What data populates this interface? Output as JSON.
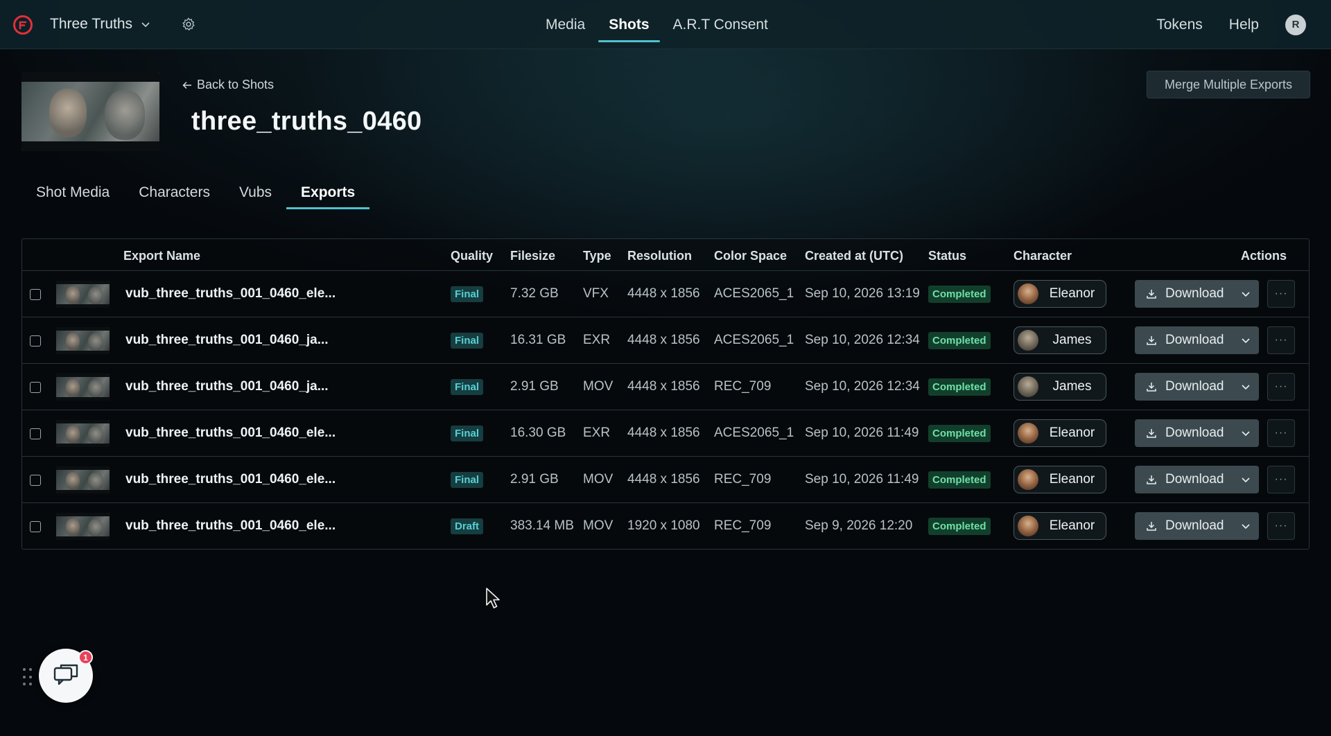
{
  "topnav": {
    "project_name": "Three Truths",
    "items": [
      {
        "label": "Media",
        "active": false
      },
      {
        "label": "Shots",
        "active": true
      },
      {
        "label": "A.R.T Consent",
        "active": false
      }
    ],
    "tokens_label": "Tokens",
    "help_label": "Help",
    "avatar_initial": "R"
  },
  "header": {
    "back_label": "Back to Shots",
    "title": "three_truths_0460",
    "merge_button": "Merge Multiple Exports"
  },
  "tabs": [
    {
      "label": "Shot Media",
      "active": false
    },
    {
      "label": "Characters",
      "active": false
    },
    {
      "label": "Vubs",
      "active": false
    },
    {
      "label": "Exports",
      "active": true
    }
  ],
  "table": {
    "columns": {
      "export_name": "Export Name",
      "quality": "Quality",
      "filesize": "Filesize",
      "type": "Type",
      "resolution": "Resolution",
      "color_space": "Color Space",
      "created_at": "Created at (UTC)",
      "status": "Status",
      "character": "Character",
      "actions": "Actions"
    },
    "download_label": "Download",
    "more_label": "···",
    "rows": [
      {
        "name": "vub_three_truths_001_0460_ele...",
        "quality": "Final",
        "filesize": "7.32 GB",
        "type": "VFX",
        "resolution": "4448 x 1856",
        "color_space": "ACES2065_1",
        "created_at": "Sep 10, 2026 13:19",
        "status": "Completed",
        "character": "Eleanor"
      },
      {
        "name": "vub_three_truths_001_0460_ja...",
        "quality": "Final",
        "filesize": "16.31 GB",
        "type": "EXR",
        "resolution": "4448 x 1856",
        "color_space": "ACES2065_1",
        "created_at": "Sep 10, 2026 12:34",
        "status": "Completed",
        "character": "James"
      },
      {
        "name": "vub_three_truths_001_0460_ja...",
        "quality": "Final",
        "filesize": "2.91 GB",
        "type": "MOV",
        "resolution": "4448 x 1856",
        "color_space": "REC_709",
        "created_at": "Sep 10, 2026 12:34",
        "status": "Completed",
        "character": "James"
      },
      {
        "name": "vub_three_truths_001_0460_ele...",
        "quality": "Final",
        "filesize": "16.30 GB",
        "type": "EXR",
        "resolution": "4448 x 1856",
        "color_space": "ACES2065_1",
        "created_at": "Sep 10, 2026 11:49",
        "status": "Completed",
        "character": "Eleanor"
      },
      {
        "name": "vub_three_truths_001_0460_ele...",
        "quality": "Final",
        "filesize": "2.91 GB",
        "type": "MOV",
        "resolution": "4448 x 1856",
        "color_space": "REC_709",
        "created_at": "Sep 10, 2026 11:49",
        "status": "Completed",
        "character": "Eleanor"
      },
      {
        "name": "vub_three_truths_001_0460_ele...",
        "quality": "Draft",
        "filesize": "383.14 MB",
        "type": "MOV",
        "resolution": "1920 x 1080",
        "color_space": "REC_709",
        "created_at": "Sep 9, 2026 12:20",
        "status": "Completed",
        "character": "Eleanor"
      }
    ]
  },
  "chat_widget": {
    "notification_count": "1"
  },
  "colors": {
    "accent": "#4fc3cf",
    "brand": "#e0303a",
    "status_completed": "#6fe0a8",
    "notification": "#e8405a"
  }
}
